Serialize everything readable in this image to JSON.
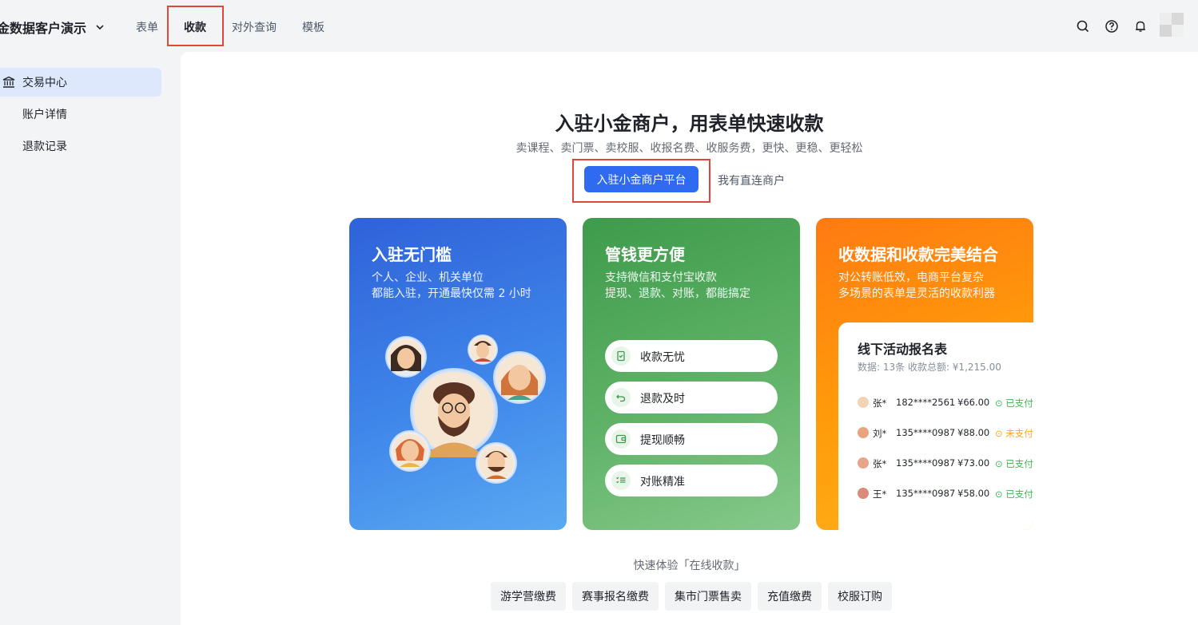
{
  "header": {
    "workspace": "金数据客户演示",
    "tabs": [
      {
        "label": "表单"
      },
      {
        "label": "收款"
      },
      {
        "label": "对外查询"
      },
      {
        "label": "模板"
      }
    ],
    "icons": [
      "search-icon",
      "help-icon",
      "bell-icon",
      "avatar"
    ]
  },
  "sidebar": {
    "items": [
      {
        "label": "交易中心",
        "icon": "bank-icon",
        "active": true
      },
      {
        "label": "账户详情"
      },
      {
        "label": "退款记录"
      }
    ]
  },
  "hero": {
    "title": "入驻小金商户，用表单快速收款",
    "subtitle": "卖课程、卖门票、卖校服、收报名费、收服务费，更快、更稳、更轻松",
    "primary_button": "入驻小金商户平台",
    "secondary_link": "我有直连商户"
  },
  "cards": {
    "card1": {
      "title": "入驻无门槛",
      "line1": "个人、企业、机关单位",
      "line2": "都能入驻，开通最快仅需 2 小时"
    },
    "card2": {
      "title": "管钱更方便",
      "line1": "支持微信和支付宝收款",
      "line2": "提现、退款、对账，都能搞定",
      "pills": [
        {
          "label": "收款无忧",
          "icon": "receipt-icon"
        },
        {
          "label": "退款及时",
          "icon": "undo-icon"
        },
        {
          "label": "提现顺畅",
          "icon": "wallet-icon"
        },
        {
          "label": "对账精准",
          "icon": "checklist-icon"
        }
      ]
    },
    "card3": {
      "title": "收数据和收款完美结合",
      "line1": "对公转账低效，电商平台复杂",
      "line2": "多场景的表单是灵活的收款利器",
      "form": {
        "title": "线下活动报名表",
        "meta": "数据: 13条    收款总额: ¥1,215.00",
        "rows": [
          {
            "name": "张*",
            "phone": "182****2561",
            "amount": "¥66.00",
            "status": "已支付"
          },
          {
            "name": "刘*",
            "phone": "135****0987",
            "amount": "¥88.00",
            "status": "未支付"
          },
          {
            "name": "张*",
            "phone": "135****0987",
            "amount": "¥73.00",
            "status": "已支付"
          },
          {
            "name": "王*",
            "phone": "135****0987",
            "amount": "¥58.00",
            "status": "已支付"
          }
        ]
      }
    }
  },
  "quick": {
    "label": "快速体验「在线收款」",
    "chips": [
      "游学营缴费",
      "赛事报名缴费",
      "集市门票售卖",
      "充值缴费",
      "校服订购"
    ]
  },
  "colors": {
    "primary": "#2f6bf0",
    "highlight_box": "#e0463b",
    "card_blue": "#2f62d9",
    "card_green": "#3e9b4c",
    "card_orange": "#ff7a12",
    "paid": "#3fb54f",
    "unpaid": "#f5a524"
  }
}
